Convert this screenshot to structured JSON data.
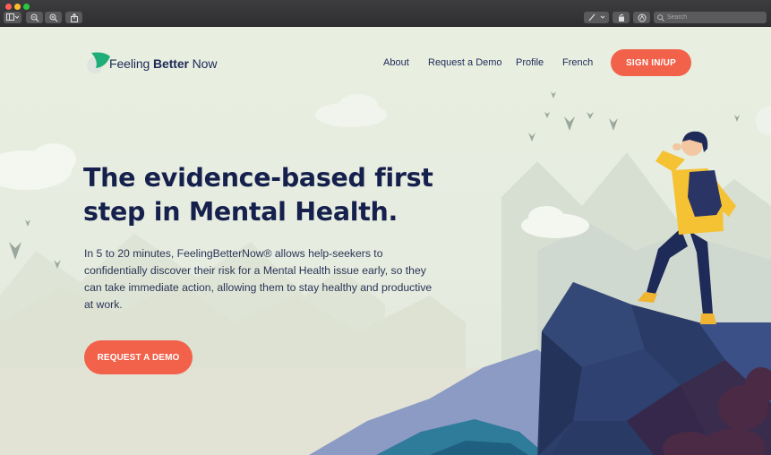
{
  "window": {
    "search_placeholder": "Search"
  },
  "brand": {
    "name_part1": "Feeling ",
    "name_part2": "Better",
    "name_part3": " Now"
  },
  "nav": {
    "items": [
      "About",
      "Request a Demo",
      "Profile",
      "French"
    ],
    "signin_label": "SIGN IN/UP"
  },
  "hero": {
    "headline_line1": "The evidence-based first",
    "headline_line2": "step in Mental Health.",
    "description": "In 5 to 20 minutes, FeelingBetterNow® allows help-seekers to confidentially discover their risk for a Mental Health issue early, so they can take immediate action, allowing them to stay healthy and productive at work.",
    "cta_label": "REQUEST A DEMO"
  },
  "colors": {
    "accent": "#f2614a",
    "navy": "#16204d",
    "logo_green": "#1fae7a"
  }
}
